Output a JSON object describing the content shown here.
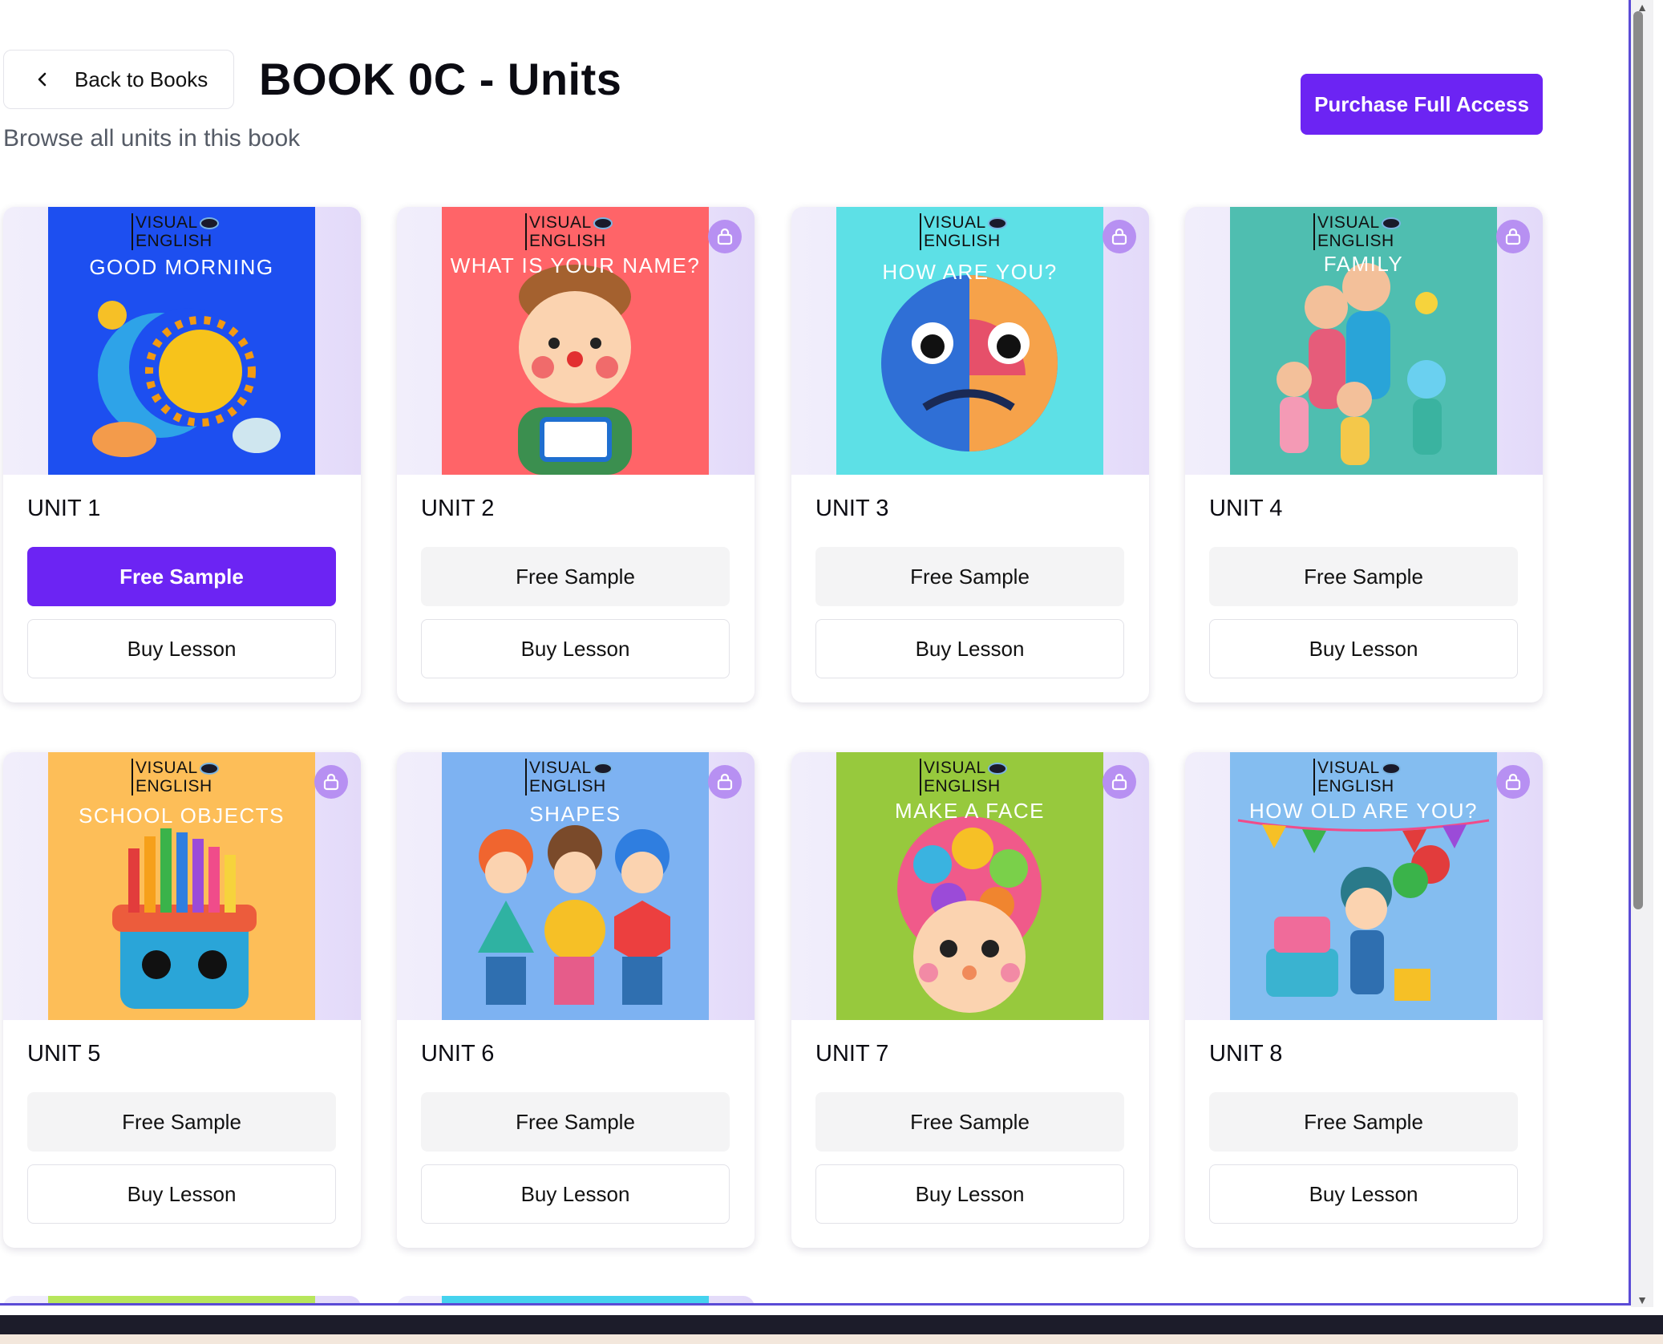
{
  "header": {
    "back_label": "Back to Books",
    "title": "BOOK 0C - Units",
    "subtitle": "Browse all units in this book",
    "purchase_label": "Purchase Full Access"
  },
  "cover_brand": [
    "VISUAL",
    "ENGLISH"
  ],
  "units": [
    {
      "label": "UNIT 1",
      "cover_title": "GOOD MORNING",
      "cover_color": "#1d4ff0",
      "locked": false,
      "sample_label": "Free Sample",
      "buy_label": "Buy Lesson"
    },
    {
      "label": "UNIT 2",
      "cover_title": "WHAT IS YOUR NAME?",
      "cover_color": "#ff6468",
      "locked": true,
      "sample_label": "Free Sample",
      "buy_label": "Buy Lesson"
    },
    {
      "label": "UNIT 3",
      "cover_title": "HOW ARE YOU?",
      "cover_color": "#5de0e6",
      "locked": true,
      "sample_label": "Free Sample",
      "buy_label": "Buy Lesson"
    },
    {
      "label": "UNIT 4",
      "cover_title": "FAMILY",
      "cover_color": "#4fbeb0",
      "locked": true,
      "sample_label": "Free Sample",
      "buy_label": "Buy Lesson"
    },
    {
      "label": "UNIT 5",
      "cover_title": "SCHOOL OBJECTS",
      "cover_color": "#fdbe58",
      "locked": true,
      "sample_label": "Free Sample",
      "buy_label": "Buy Lesson"
    },
    {
      "label": "UNIT 6",
      "cover_title": "SHAPES",
      "cover_color": "#7db2f2",
      "locked": true,
      "sample_label": "Free Sample",
      "buy_label": "Buy Lesson"
    },
    {
      "label": "UNIT 7",
      "cover_title": "MAKE A FACE",
      "cover_color": "#97c93d",
      "locked": true,
      "sample_label": "Free Sample",
      "buy_label": "Buy Lesson"
    },
    {
      "label": "UNIT 8",
      "cover_title": "HOW OLD ARE YOU?",
      "cover_color": "#84bdf0",
      "locked": true,
      "sample_label": "Free Sample",
      "buy_label": "Buy Lesson"
    }
  ],
  "peek_colors": [
    "#b7e65c",
    "#45d3ee"
  ],
  "colors": {
    "accent": "#6c24f3",
    "lock_badge": "#b790f2"
  }
}
